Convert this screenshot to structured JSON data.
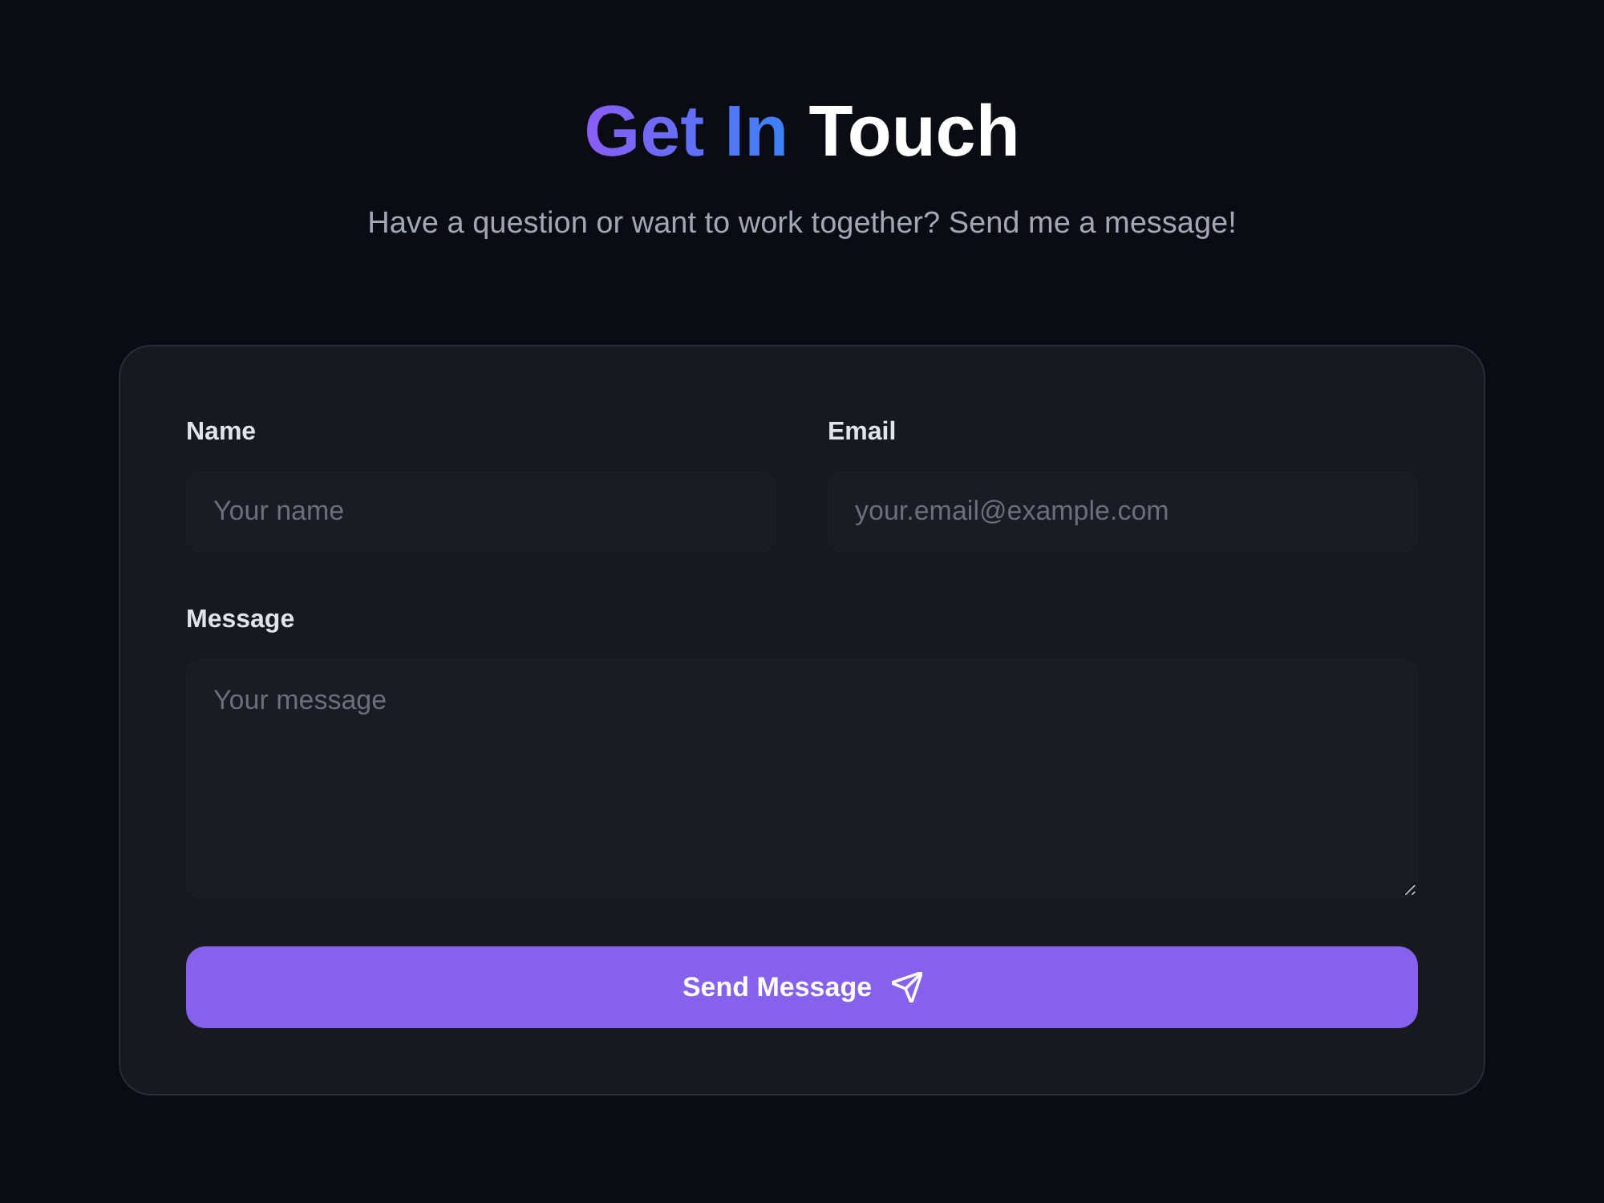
{
  "header": {
    "title_accent": "Get In",
    "title_rest": "Touch",
    "subtitle": "Have a question or want to work together? Send me a message!"
  },
  "form": {
    "fields": [
      {
        "kind": "text",
        "label": "Name",
        "placeholder": "Your name"
      },
      {
        "kind": "text",
        "label": "Email",
        "placeholder": "your.email@example.com"
      },
      {
        "kind": "textarea",
        "label": "Message",
        "placeholder": "Your message"
      }
    ],
    "submit_button": "Send Message"
  }
}
